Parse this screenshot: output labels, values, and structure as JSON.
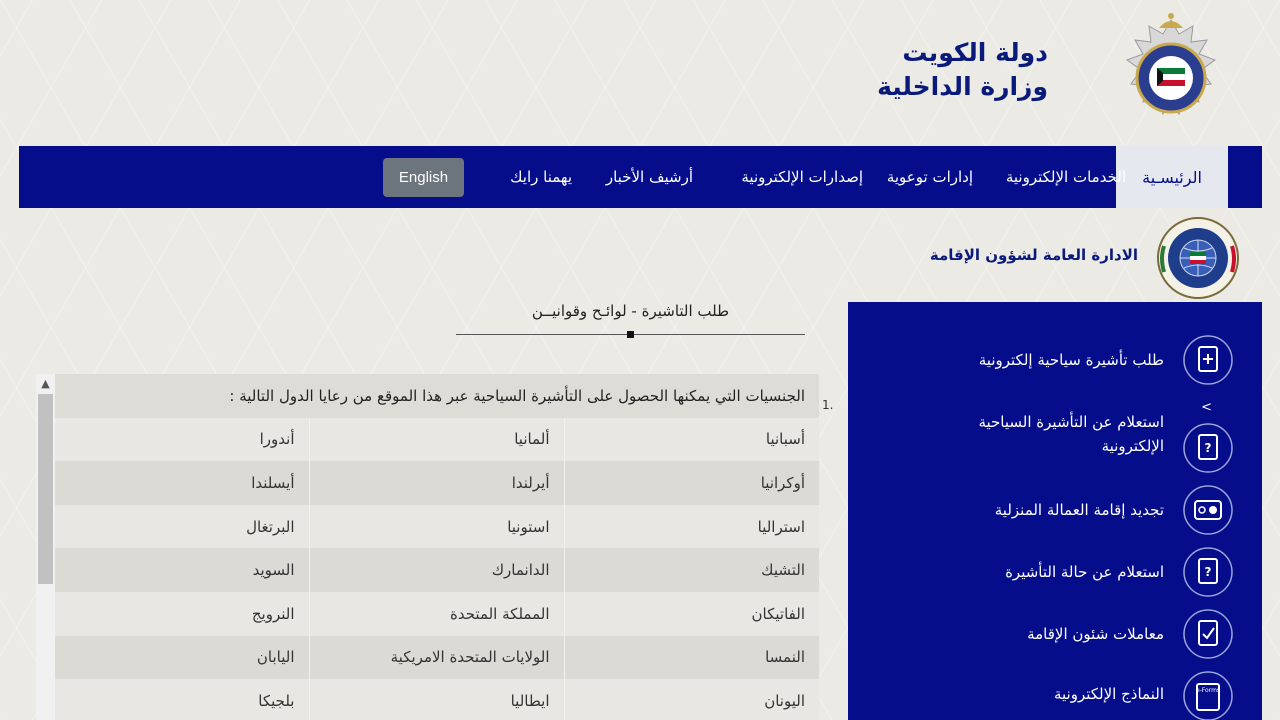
{
  "header": {
    "country": "دولة الكويت",
    "ministry": "وزارة الداخلية",
    "logo_text": "KUWAIT POLICE"
  },
  "nav": {
    "home": "الرئيسـية",
    "eservices": "الخدمات الإلكترونية",
    "awareness": "إدارات توعوية",
    "epublications": "إصدارات الإلكترونية",
    "news_archive": "أرشيف الأخبار",
    "feedback": "يهمنا رايك",
    "language": "English"
  },
  "department": {
    "title": "الادارة العامة لشؤون الإقامة"
  },
  "sidebar": {
    "items": [
      {
        "label": "طلب تأشيرة سياحية إلكترونية",
        "icon": "doc-plus-icon"
      },
      {
        "label": "استعلام عن التأشيرة السياحية الإلكترونية",
        "icon": "doc-question-icon",
        "caret": ">"
      },
      {
        "label": "تجديد إقامة العمالة المنزلية",
        "icon": "id-card-icon"
      },
      {
        "label": "استعلام عن حالة التأشيرة",
        "icon": "doc-question-icon"
      },
      {
        "label": "معاملات شئون الإقامة",
        "icon": "doc-check-icon"
      },
      {
        "label": "النماذج الإلكترونية",
        "icon": "eforms-icon",
        "icon_text": "e-Forms"
      }
    ]
  },
  "main": {
    "heading": "طلب التاشيرة - لوائـح وقوانيــن",
    "list_number": "1.",
    "table_header": "الجنسيات التي يمكنها الحصول على التأشيرة السياحية عبر هذا الموقع من رعايا الدول التالية :",
    "rows": [
      [
        "أسبانيا",
        "ألمانيا",
        "أندورا"
      ],
      [
        "أوكرانيا",
        "أيرلندا",
        "أيسلندا"
      ],
      [
        "استراليا",
        "استونيا",
        "البرتغال"
      ],
      [
        "التشيك",
        "الدانمارك",
        "السويد"
      ],
      [
        "الفاتيكان",
        "المملكة المتحدة",
        "النرويج"
      ],
      [
        "النمسا",
        "الولايات المتحدة الامريكية",
        "اليابان"
      ],
      [
        "اليونان",
        "ايطاليا",
        "بلجيكا"
      ]
    ]
  },
  "colors": {
    "navy": "#050d8a",
    "title_blue": "#0a1a7a",
    "button_gray": "#6c757d"
  }
}
